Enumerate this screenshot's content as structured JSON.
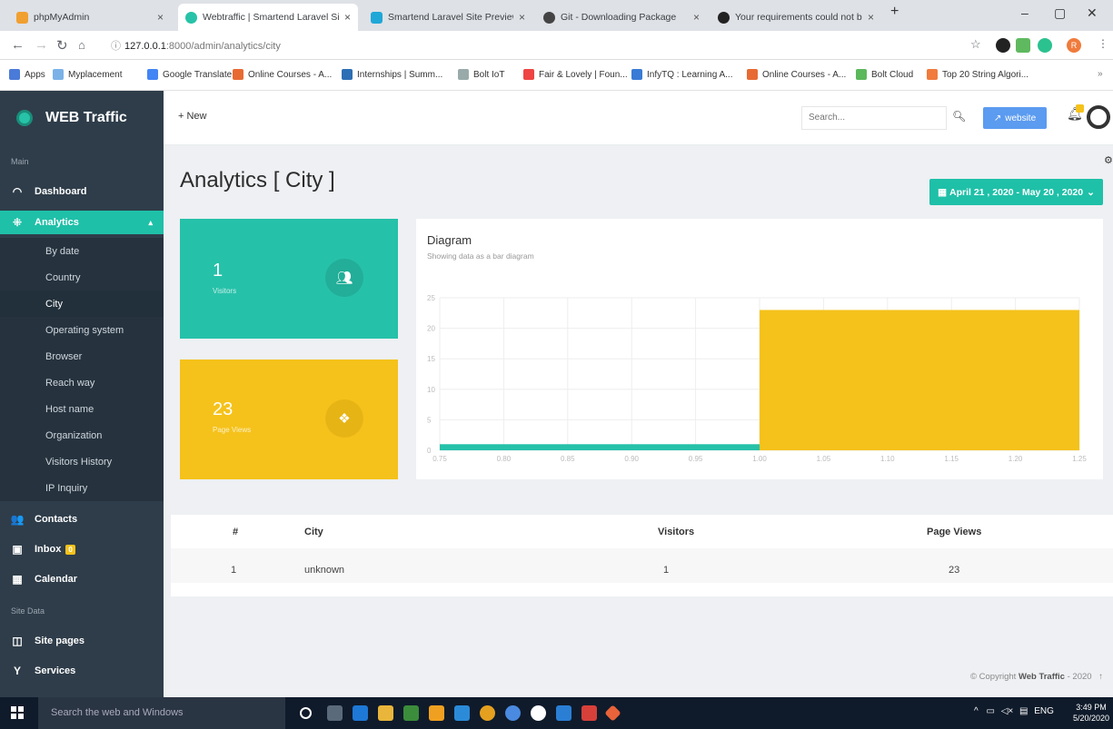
{
  "browser": {
    "tabs": [
      {
        "label": "phpMyAdmin",
        "close": "×"
      },
      {
        "label": "Webtraffic | Smartend Laravel Si",
        "close": "×"
      },
      {
        "label": "Smartend Laravel Site Preview",
        "close": "×"
      },
      {
        "label": "Git - Downloading Package",
        "close": "×"
      },
      {
        "label": "Your requirements could not be",
        "close": "×"
      }
    ],
    "new_tab": "+",
    "url_host": "127.0.0.1",
    "url_path": ":8000/admin/analytics/city",
    "profile_letter": "R",
    "bookmarks": [
      "Apps",
      "Myplacement",
      "Google Translate",
      "Online Courses - A...",
      "Internships | Summ...",
      "Bolt IoT",
      "Fair & Lovely | Foun...",
      "InfyTQ : Learning A...",
      "Online Courses - A...",
      "Bolt Cloud",
      "Top 20 String Algori..."
    ],
    "bookmarks_more": "»"
  },
  "sidebar": {
    "brand": "WEB Traffic",
    "section_main": "Main",
    "section_site": "Site Data",
    "items": [
      {
        "label": "Dashboard",
        "icon": "speedometer-icon"
      },
      {
        "label": "Analytics",
        "icon": "analytics-icon"
      }
    ],
    "analytics_sub": [
      "By date",
      "Country",
      "City",
      "Operating system",
      "Browser",
      "Reach way",
      "Host name",
      "Organization",
      "Visitors History",
      "IP Inquiry"
    ],
    "lower_items": [
      {
        "label": "Contacts",
        "icon": "contacts-icon"
      },
      {
        "label": "Inbox",
        "icon": "inbox-icon",
        "badge": "0"
      },
      {
        "label": "Calendar",
        "icon": "calendar-icon"
      }
    ],
    "site_items": [
      {
        "label": "Site pages",
        "icon": "pages-icon"
      },
      {
        "label": "Services",
        "icon": "services-icon"
      }
    ]
  },
  "topbar": {
    "new_label": "+ New",
    "search_placeholder": "Search...",
    "website_label": "website",
    "notif_count": "0"
  },
  "page": {
    "title": "Analytics [ City ]",
    "date_range": "April 21 , 2020 - May 20 , 2020"
  },
  "stats": {
    "visitors_value": "1",
    "visitors_label": "Visitors",
    "pageviews_value": "23",
    "pageviews_label": "Page Views"
  },
  "chart_card": {
    "title": "Diagram",
    "subtitle": "Showing data as a bar diagram"
  },
  "chart_data": {
    "type": "bar",
    "x_ticks": [
      "0.75",
      "0.80",
      "0.85",
      "0.90",
      "0.95",
      "1.00",
      "1.05",
      "1.10",
      "1.15",
      "1.20",
      "1.25"
    ],
    "y_ticks": [
      "0",
      "5",
      "10",
      "15",
      "20",
      "25"
    ],
    "ylim": [
      0,
      25
    ],
    "xlim": [
      0.75,
      1.25
    ],
    "series": [
      {
        "name": "Visitors",
        "x_range": [
          0.75,
          1.0
        ],
        "value": 1,
        "color": "#26c1a9"
      },
      {
        "name": "Page Views",
        "x_range": [
          1.0,
          1.25
        ],
        "value": 23,
        "color": "#f5c21b"
      }
    ]
  },
  "table": {
    "headers": [
      "#",
      "City",
      "Visitors",
      "Page Views"
    ],
    "rows": [
      [
        "1",
        "unknown",
        "1",
        "23"
      ]
    ]
  },
  "footer": {
    "prefix": "© Copyright ",
    "brand": "Web Traffic",
    "suffix": " - 2020"
  },
  "taskbar": {
    "search": "Search the web and Windows",
    "lang": "ENG",
    "time": "3:49 PM",
    "date": "5/20/2020"
  },
  "colors": {
    "teal": "#26c1a9",
    "yellow": "#f5c21b",
    "sidebar": "#2f3d4a",
    "blue": "#5b9bf0"
  }
}
